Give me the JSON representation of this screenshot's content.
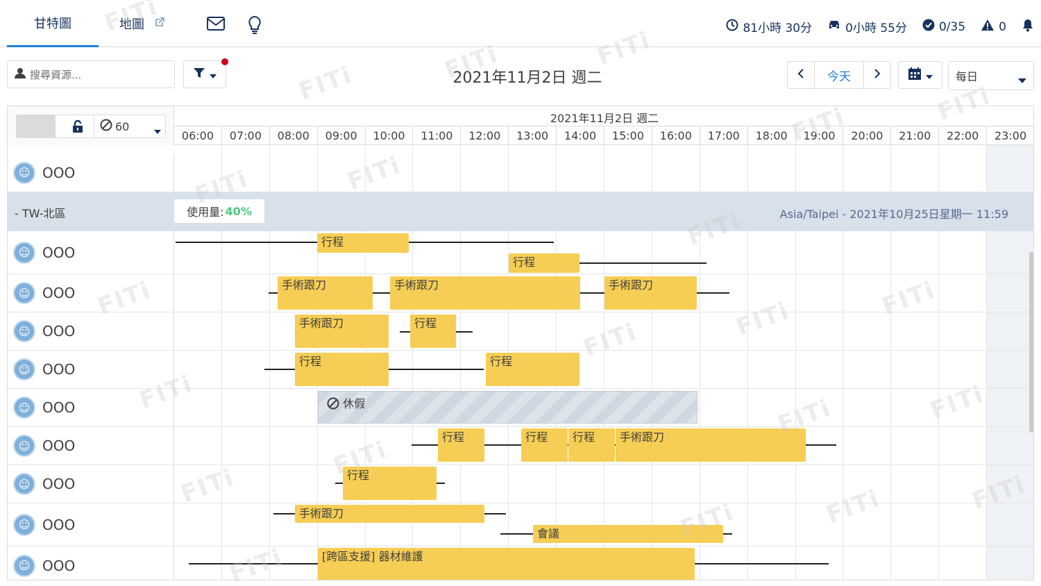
{
  "tabs": [
    {
      "label": "甘特圖",
      "active": true
    },
    {
      "label": "地圖",
      "active": false
    }
  ],
  "header_stats": {
    "total_time": "81小時 30分",
    "travel_time": "0小時 55分",
    "completed": "0/35",
    "warnings": "0"
  },
  "toolbar": {
    "search_placeholder": "搜尋資源...",
    "date_title": "2021年11月2日 週二",
    "today_label": "今天",
    "view_mode": "每日"
  },
  "gantt": {
    "day_label": "2021年11月2日 週二",
    "resolution_value": "60",
    "hours": [
      "06:00",
      "07:00",
      "08:00",
      "09:00",
      "10:00",
      "11:00",
      "12:00",
      "13:00",
      "14:00",
      "15:00",
      "16:00",
      "17:00",
      "18:00",
      "19:00",
      "20:00",
      "21:00",
      "22:00",
      "23:00"
    ],
    "region": {
      "name": "- TW-北區",
      "usage_label": "使用量:",
      "usage_value": "40%",
      "timezone_text": "Asia/Taipei - 2021年10月25日星期一 11:59"
    },
    "resources": [
      "OOO",
      "OOO",
      "OOO",
      "OOO",
      "OOO",
      "OOO",
      "OOO",
      "OOO",
      "OOO",
      "OOO"
    ],
    "events": {
      "trip": "行程",
      "surgery": "手術跟刀",
      "leave": "休假",
      "meeting": "會議",
      "support": "[跨區支援] 器材維護"
    }
  },
  "watermark": "FITi",
  "colors": {
    "accent": "#1b7fd6",
    "event": "#f7ce55",
    "region_band": "#d8e1ea",
    "usage_green": "#4bca81",
    "notification_dot": "#d0021b"
  }
}
